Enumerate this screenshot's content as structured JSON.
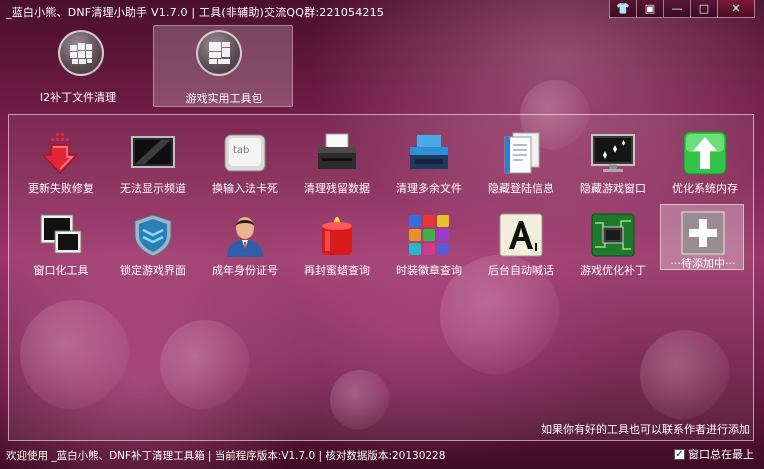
{
  "window": {
    "title": "_蓝白小熊、DNF清理小助手 V1.7.0  |  工具(非辅助)交流QQ群:221054215",
    "buttons": {
      "skin": "👕",
      "menu": "▣",
      "minimize": "—",
      "maximize": "□",
      "close": "✕"
    }
  },
  "tabs": [
    {
      "label": "I2补丁文件清理",
      "icon": "grid-circle-icon"
    },
    {
      "label": "游戏实用工具包",
      "icon": "layout-circle-icon"
    }
  ],
  "tools": [
    {
      "label": "更新失败修复",
      "icon": "download-arrow-icon"
    },
    {
      "label": "无法显示频道",
      "icon": "monitor-icon"
    },
    {
      "label": "换输入法卡死",
      "icon": "tab-key-icon"
    },
    {
      "label": "清理残留数据",
      "icon": "shredder-icon"
    },
    {
      "label": "清理多余文件",
      "icon": "file-tray-icon"
    },
    {
      "label": "隐藏登陆信息",
      "icon": "documents-icon"
    },
    {
      "label": "隐藏游戏窗口",
      "icon": "sparkle-monitor-icon"
    },
    {
      "label": "优化系统内存",
      "icon": "green-boost-icon"
    },
    {
      "label": "窗口化工具",
      "icon": "windows-icon"
    },
    {
      "label": "锁定游戏界面",
      "icon": "shield-icon"
    },
    {
      "label": "成年身份证号",
      "icon": "person-icon"
    },
    {
      "label": "再封蜜蜡查询",
      "icon": "red-candle-icon"
    },
    {
      "label": "时装徽章查询",
      "icon": "color-tiles-icon"
    },
    {
      "label": "后台自动喊话",
      "icon": "font-a-icon"
    },
    {
      "label": "游戏优化补丁",
      "icon": "chip-icon"
    },
    {
      "label": "···待添加中···",
      "icon": "plus-icon"
    }
  ],
  "hint": "如果你有好的工具也可以联系作者进行添加",
  "statusbar": {
    "text": "欢迎使用 _蓝白小熊、DNF补丁清理工具箱 | 当前程序版本:V1.7.0 | 核对数据版本:20130228",
    "ontop_label": "窗口总在最上",
    "ontop_checked": "✓"
  }
}
